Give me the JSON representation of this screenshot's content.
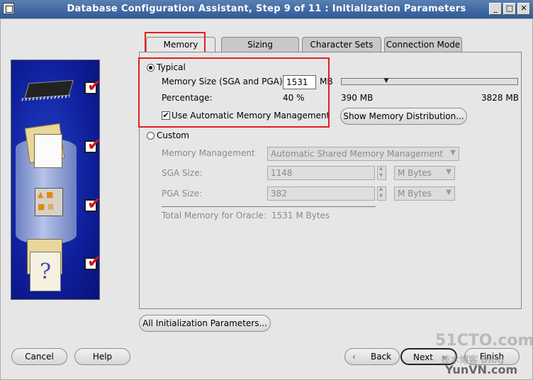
{
  "window": {
    "title": "Database Configuration Assistant, Step 9 of 11 : Initialization Parameters",
    "minimize_glyph": "_",
    "maximize_glyph": "□",
    "close_glyph": "✕"
  },
  "tabs": [
    {
      "label": "Memory",
      "active": true
    },
    {
      "label": "Sizing",
      "active": false
    },
    {
      "label": "Character Sets",
      "active": false
    },
    {
      "label": "Connection Mode",
      "active": false
    }
  ],
  "typical": {
    "label": "Typical",
    "selected": true,
    "memory_size_label": "Memory Size (SGA and PGA):",
    "memory_size_value": "1531",
    "memory_size_unit": "MB",
    "percentage_label": "Percentage:",
    "percentage_value": "40 %",
    "slider_fraction": 0.24,
    "slider_min_label": "390 MB",
    "slider_max_label": "3828 MB",
    "auto_memory_label": "Use Automatic Memory Management",
    "auto_memory_checked": true,
    "show_distribution_label": "Show Memory Distribution..."
  },
  "custom": {
    "label": "Custom",
    "selected": false,
    "memory_management_label": "Memory Management",
    "memory_management_value": "Automatic Shared Memory Management",
    "sga_label": "SGA Size:",
    "sga_value": "1148",
    "sga_unit": "M Bytes",
    "pga_label": "PGA Size:",
    "pga_value": "382",
    "pga_unit": "M Bytes",
    "total_label": "Total Memory for Oracle:",
    "total_value": "1531 M Bytes"
  },
  "buttons": {
    "all_params": "All Initialization Parameters...",
    "cancel": "Cancel",
    "help": "Help",
    "back": "Back",
    "next": "Next",
    "finish": "Finish"
  },
  "icons": {
    "back": "chevron-left-icon",
    "next": "double-chevron-right-icon"
  },
  "watermark": {
    "line1": "51CTO.com",
    "line2": "技术博客 Blog",
    "line3": "YunVN.com"
  },
  "colors": {
    "title_bar": "#2f5a97",
    "highlight_box": "#e02020",
    "banner": "#0f1f9a"
  }
}
